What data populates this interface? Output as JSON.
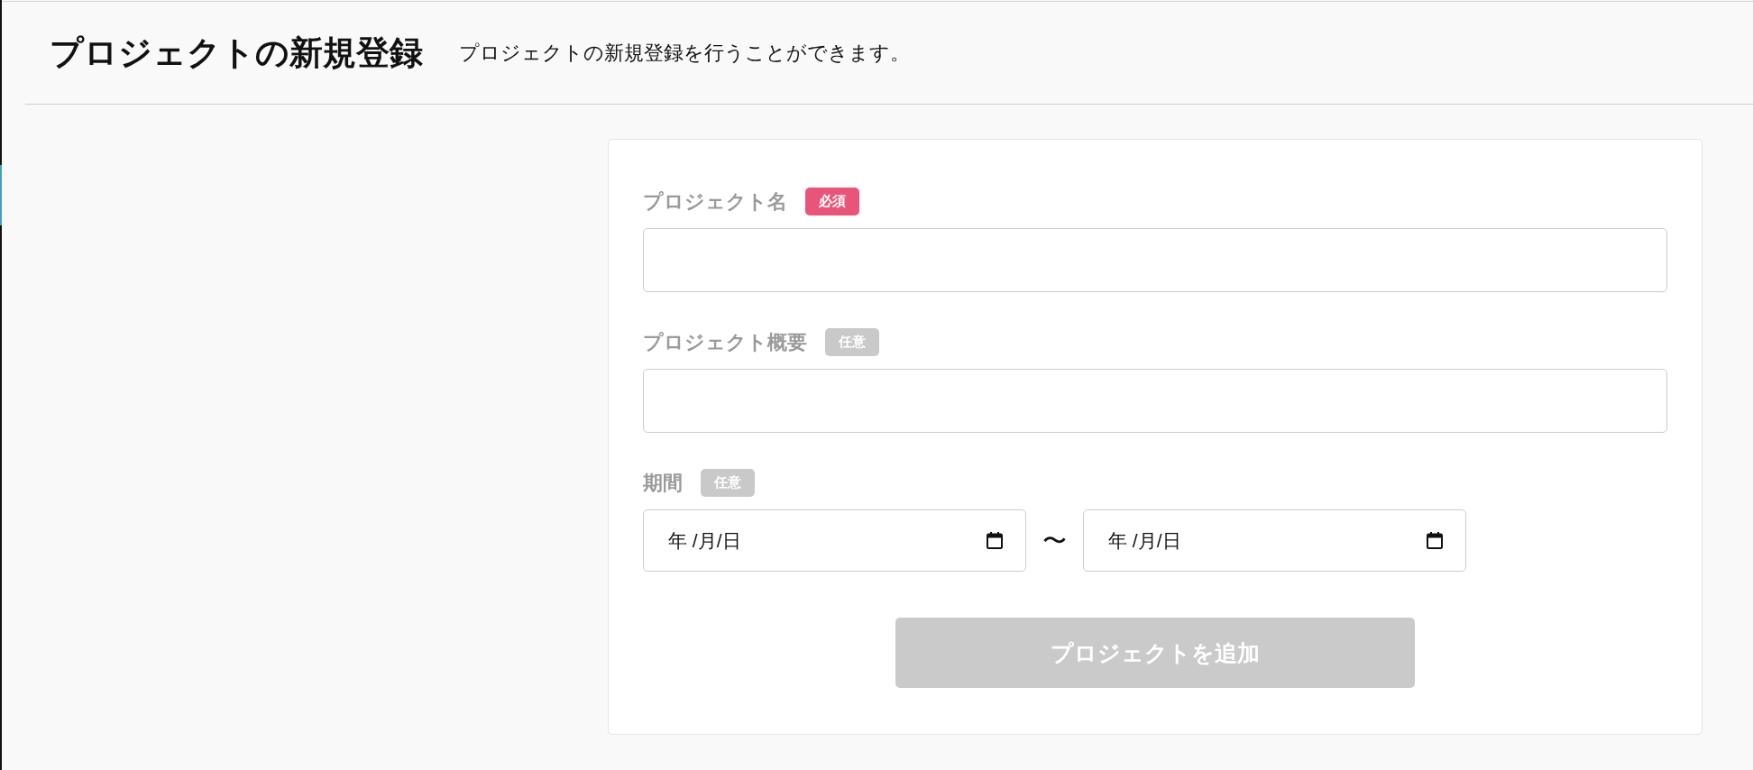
{
  "header": {
    "title": "プロジェクトの新規登録",
    "description": "プロジェクトの新規登録を行うことができます。"
  },
  "form": {
    "fields": [
      {
        "kind": "text",
        "label": "プロジェクト名",
        "badge": "必須",
        "required": true
      },
      {
        "kind": "text",
        "label": "プロジェクト概要",
        "badge": "任意",
        "required": false
      },
      {
        "kind": "date_range",
        "label": "期間",
        "badge": "任意",
        "required": false,
        "start": {
          "placeholder": "年 /月/日"
        },
        "separator": "〜",
        "end": {
          "placeholder": "年 /月/日"
        }
      }
    ],
    "submit": {
      "label": "プロジェクトを追加",
      "disabled": true
    }
  }
}
